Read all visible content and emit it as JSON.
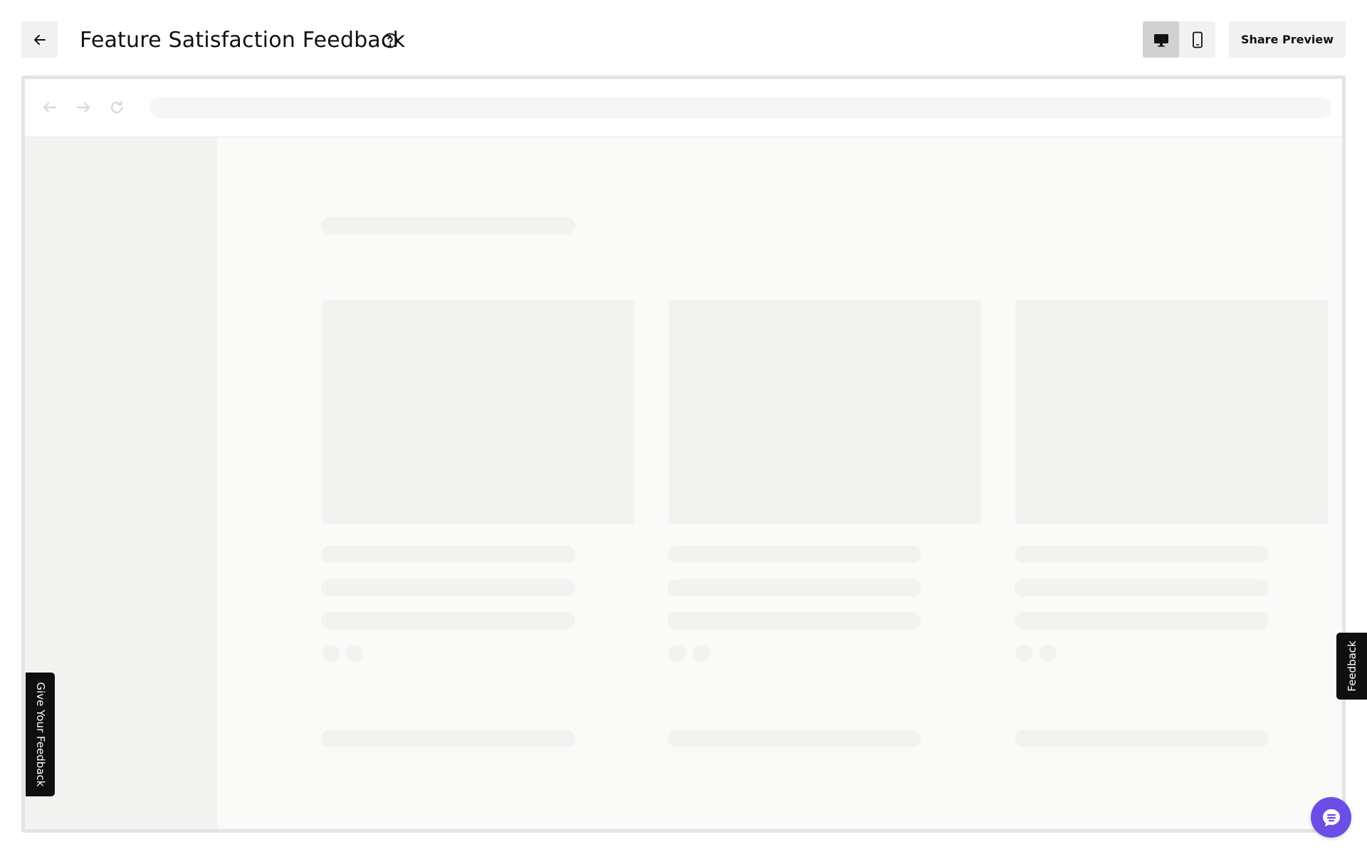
{
  "header": {
    "title": "Feature Satisfaction Feedback",
    "back_icon": "arrow-left-icon",
    "help_icon": "question-circle-icon",
    "device_toggle": {
      "selected": "desktop",
      "options": [
        "desktop",
        "mobile"
      ]
    },
    "share_label": "Share Preview"
  },
  "preview": {
    "browser_nav_icons": [
      "arrow-left-icon",
      "arrow-right-icon",
      "reload-icon"
    ],
    "cards_visible": 3
  },
  "widgets": {
    "give_feedback_label": "Give Your Feedback",
    "feedback_label": "Feedback",
    "chat_icon": "chat-bubble-icon",
    "chat_color": "#6a4ee6"
  },
  "colors": {
    "button_bg": "#f1f1f1",
    "active_toggle_bg": "#cfd1d3",
    "skeleton": "#f2f2f1",
    "tab_bg": "#0f0f0f"
  }
}
